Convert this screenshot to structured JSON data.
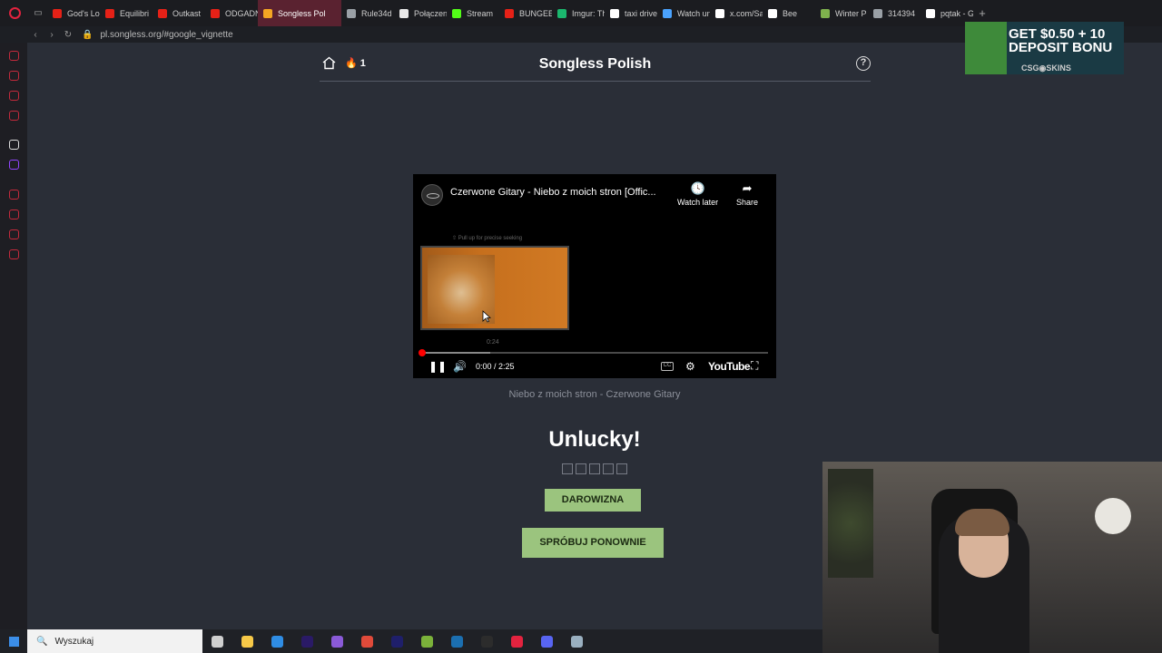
{
  "browser": {
    "tabs": [
      {
        "label": "God's Lo",
        "color": "#e62117"
      },
      {
        "label": "Equilibri",
        "color": "#e62117"
      },
      {
        "label": "Outkast",
        "color": "#e62117"
      },
      {
        "label": "ODGADN",
        "color": "#e62117"
      },
      {
        "label": "Songless Pol",
        "color": "#f5a623",
        "active": true
      },
      {
        "label": "Rule34d",
        "color": "#9aa0a6"
      },
      {
        "label": "Połączen",
        "color": "#e9e9e9"
      },
      {
        "label": "Stream",
        "color": "#53fc18"
      },
      {
        "label": "BUNGEE",
        "color": "#e62117"
      },
      {
        "label": "Imgur: Th",
        "color": "#1bb76e"
      },
      {
        "label": "taxi drive",
        "color": "#ffffff"
      },
      {
        "label": "Watch un",
        "color": "#4aa3ff"
      },
      {
        "label": "x.com/Sa",
        "color": "#ffffff"
      },
      {
        "label": "Bee",
        "color": "#ffffff"
      },
      {
        "label": "Winter P",
        "color": "#7fb24d"
      },
      {
        "label": "314394",
        "color": "#9aa0a6"
      },
      {
        "label": "pqtak - G",
        "color": "#ffffff"
      }
    ],
    "new_tab": "+",
    "url": "pl.songless.org/#google_vignette"
  },
  "ad": {
    "line1": "GET $0.50 + 10",
    "line2": "DEPOSIT BONU",
    "brand": "CSG◉SKINS"
  },
  "header": {
    "streak_count": "1",
    "flame": "🔥",
    "title": "Songless Polish",
    "help": "?"
  },
  "player": {
    "video_title": "Czerwone Gitary - Niebo z moich stron [Offic...",
    "watch_later": "Watch later",
    "share": "Share",
    "seek_hint": "⇧ Pull up for precise seeking",
    "preview_time": "0:24",
    "time": "0:00 / 2:25",
    "cc": "CC",
    "logo": "YouTube",
    "progress_fraction": 0.0,
    "buffered_fraction": 0.2
  },
  "song_caption": "Niebo z moich stron - Czerwone Gitary",
  "result_title": "Unlucky!",
  "attempts": 5,
  "buttons": {
    "donate": "DAROWIZNA",
    "retry": "SPRÓBUJ PONOWNIE"
  },
  "taskbar": {
    "search_placeholder": "Wyszukaj",
    "icons": [
      {
        "name": "task-view-icon",
        "color": "#cfcfcf"
      },
      {
        "name": "file-explorer-icon",
        "color": "#f7c948"
      },
      {
        "name": "vscode-icon",
        "color": "#2f8de4"
      },
      {
        "name": "premiere-icon",
        "color": "#2a1a66"
      },
      {
        "name": "app-icon",
        "color": "#8a5ad8"
      },
      {
        "name": "chrome-icon",
        "color": "#e04a3a"
      },
      {
        "name": "after-effects-icon",
        "color": "#1f1f6a"
      },
      {
        "name": "minecraft-icon",
        "color": "#7bb23a"
      },
      {
        "name": "steam-icon",
        "color": "#1b6fb0"
      },
      {
        "name": "obs-icon",
        "color": "#2c2c2c"
      },
      {
        "name": "opera-gx-icon",
        "color": "#e3233f"
      },
      {
        "name": "discord-icon",
        "color": "#5865f2"
      },
      {
        "name": "misc-app-icon",
        "color": "#9ab0c0"
      }
    ]
  }
}
